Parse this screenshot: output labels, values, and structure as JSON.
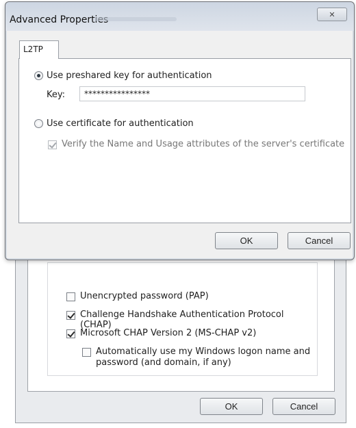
{
  "foreground_dialog": {
    "title": "Advanced Properties",
    "close_glyph": "✕",
    "tab_label": "L2TP",
    "radio_preshared": "Use preshared key for authentication",
    "key_label": "Key:",
    "key_value": "****************",
    "radio_certificate": "Use certificate for authentication",
    "verify_checkbox": "Verify the Name and Usage attributes of the server's certificate",
    "ok_label": "OK",
    "cancel_label": "Cancel"
  },
  "background_dialog": {
    "pap_label": "Unencrypted password (PAP)",
    "chap_label": "Challenge Handshake Authentication Protocol (CHAP)",
    "mschap_label": "Microsoft CHAP Version 2 (MS-CHAP v2)",
    "autologon_line1": "Automatically use my Windows logon name and",
    "autologon_line2": "password (and domain, if any)",
    "ok_label": "OK",
    "cancel_label": "Cancel"
  }
}
